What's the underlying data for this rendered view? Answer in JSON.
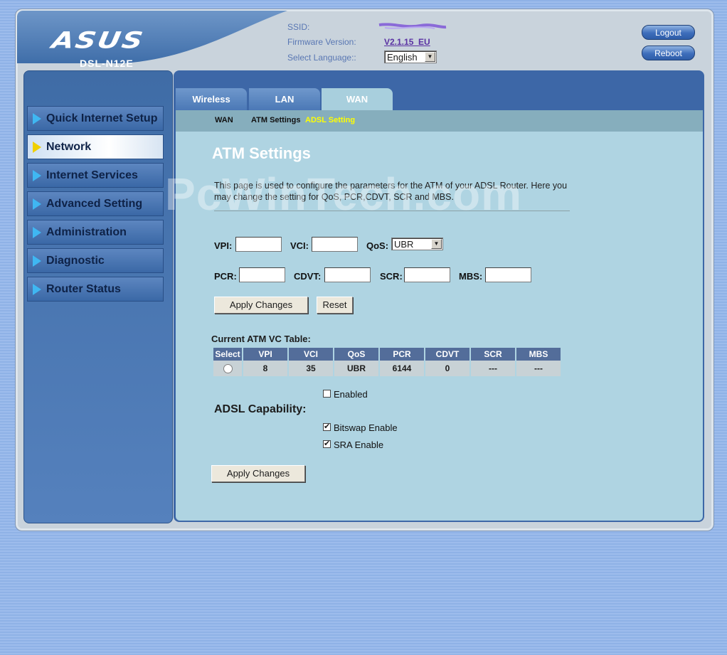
{
  "header": {
    "logo": "ASUS",
    "model": "DSL-N12E",
    "ssid_label": "SSID:",
    "firmware_label": "Firmware Version:",
    "firmware_value": "V2.1.15_EU",
    "language_label": "Select Language::",
    "language_value": "English",
    "logout_label": "Logout",
    "reboot_label": "Reboot"
  },
  "sidebar": {
    "items": [
      {
        "label": "Quick Internet Setup"
      },
      {
        "label": "Network",
        "active": true
      },
      {
        "label": "Internet Services"
      },
      {
        "label": "Advanced Setting"
      },
      {
        "label": "Administration"
      },
      {
        "label": "Diagnostic"
      },
      {
        "label": "Router Status"
      }
    ]
  },
  "tabs": [
    {
      "label": "Wireless"
    },
    {
      "label": "LAN"
    },
    {
      "label": "WAN",
      "active": true
    }
  ],
  "subnav": {
    "wan": "WAN",
    "atm": "ATM Settings",
    "adsl": "ADSL Setting"
  },
  "watermark": "PcWinTech.com",
  "page": {
    "title": "ATM Settings",
    "description": "This page is used to configure the parameters for the ATM of your ADSL Router. Here you may change the setting for QoS, PCR,CDVT, SCR and MBS."
  },
  "form": {
    "vpi_label": "VPI:",
    "vci_label": "VCI:",
    "qos_label": "QoS:",
    "qos_value": "UBR",
    "pcr_label": "PCR:",
    "cdvt_label": "CDVT:",
    "scr_label": "SCR:",
    "mbs_label": "MBS:",
    "apply_label": "Apply Changes",
    "reset_label": "Reset"
  },
  "vc_table": {
    "title": "Current ATM VC Table:",
    "headers": [
      "Select",
      "VPI",
      "VCI",
      "QoS",
      "PCR",
      "CDVT",
      "SCR",
      "MBS"
    ],
    "rows": [
      [
        "",
        "8",
        "35",
        "UBR",
        "6144",
        "0",
        "---",
        "---"
      ]
    ]
  },
  "adsl": {
    "title": "ADSL Capability:",
    "enabled_label": "Enabled",
    "enabled_checked": false,
    "bitswap_label": "Bitswap Enable",
    "bitswap_checked": true,
    "sra_label": "SRA Enable",
    "sra_checked": true,
    "apply_label": "Apply Changes"
  },
  "colors": {
    "content_bg": "#afd4e2",
    "sidebar_bg": "#3f6ca6",
    "table_header": "#536d9a",
    "subnav_active": "#ffff00"
  }
}
